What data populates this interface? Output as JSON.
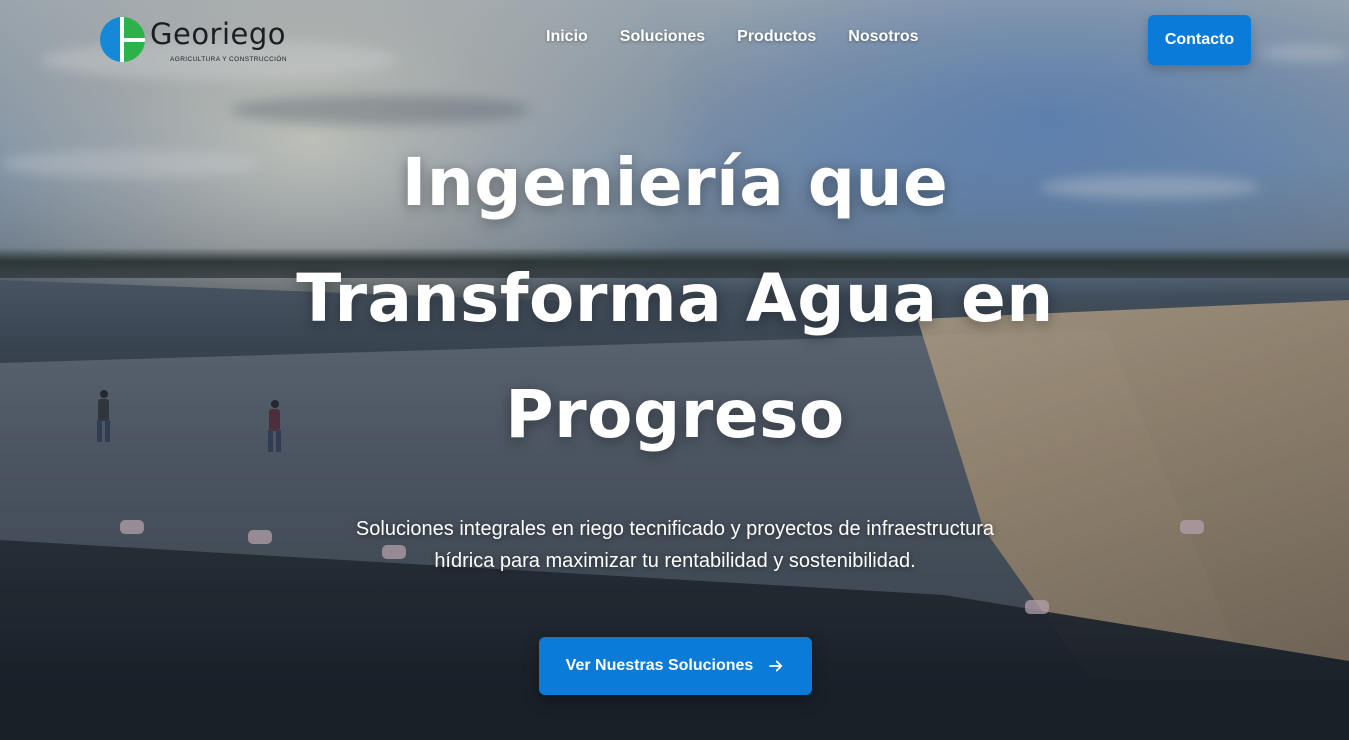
{
  "brand": {
    "name": "Georiego",
    "tagline": "AGRICULTURA Y CONSTRUCCIÓN",
    "colors": {
      "blue": "#1688d8",
      "green": "#2db24a"
    }
  },
  "nav": {
    "items": [
      {
        "label": "Inicio"
      },
      {
        "label": "Soluciones"
      },
      {
        "label": "Productos"
      },
      {
        "label": "Nosotros"
      }
    ],
    "contact_label": "Contacto"
  },
  "hero": {
    "title_line1": "Ingeniería que",
    "title_line2": "Transforma Agua en",
    "title_line3": "Progreso",
    "subtitle_line1": "Soluciones integrales en riego tecnificado y proyectos de infraestructura",
    "subtitle_line2": "hídrica para maximizar tu rentabilidad y sostenibilidad.",
    "cta_label": "Ver Nuestras Soluciones",
    "cta_icon": "arrow-right-icon",
    "accent_color": "#0a7bd8"
  }
}
